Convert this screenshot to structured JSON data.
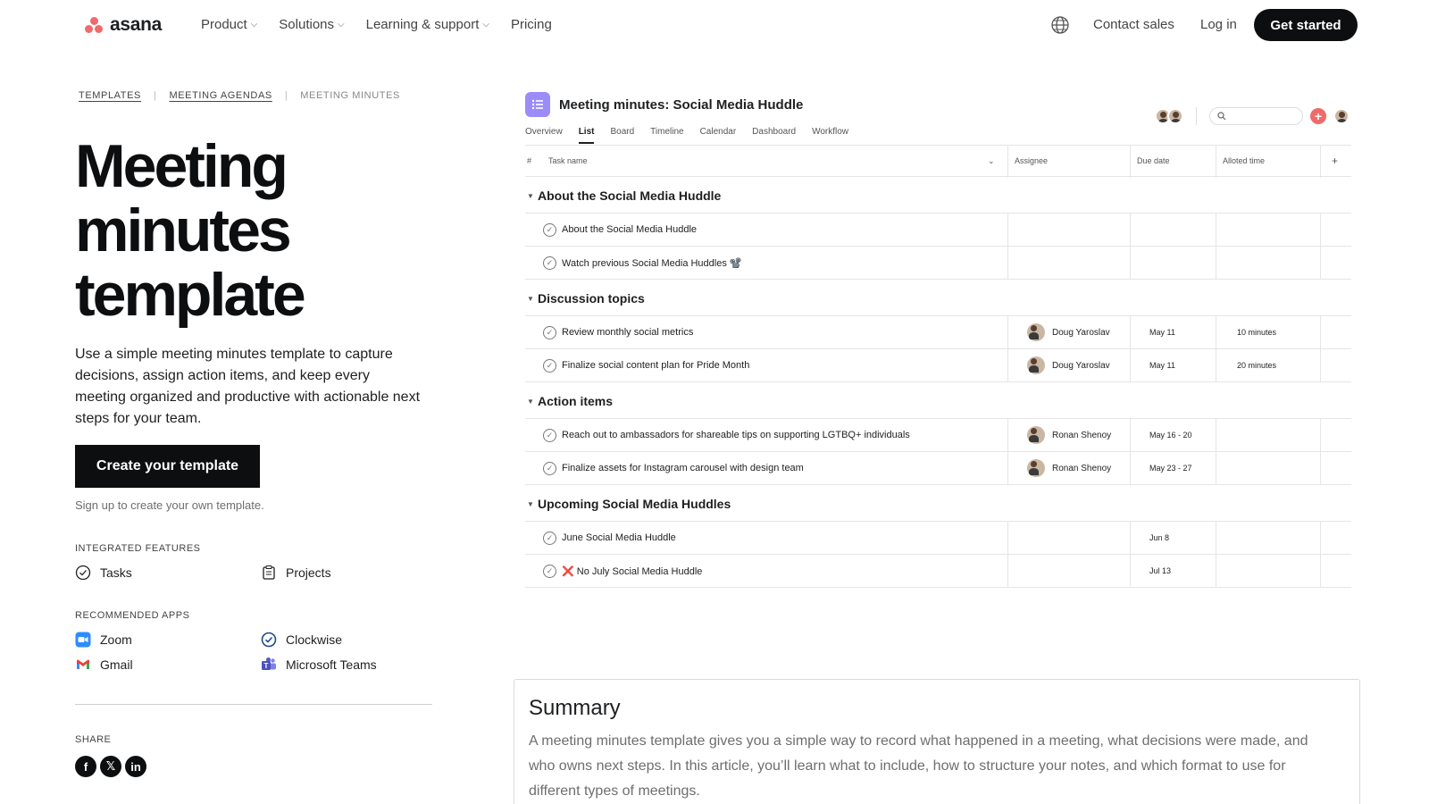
{
  "nav": {
    "brand": "asana",
    "menu": [
      {
        "label": "Product",
        "has_dropdown": true
      },
      {
        "label": "Solutions",
        "has_dropdown": true
      },
      {
        "label": "Learning & support",
        "has_dropdown": true
      },
      {
        "label": "Pricing",
        "has_dropdown": false
      }
    ],
    "language_icon": "globe-icon",
    "contact_sales": "Contact sales",
    "log_in": "Log in",
    "get_started": "Get started"
  },
  "breadcrumbs": [
    "TEMPLATES",
    "MEETING AGENDAS",
    "MEETING MINUTES"
  ],
  "hero": {
    "title_lines": [
      "Meeting",
      "minutes",
      "template"
    ],
    "description": "Use a simple meeting minutes template to capture decisions, assign action items, and keep every meeting organized and productive with actionable next steps for your team.",
    "cta": "Create your template",
    "signup_note": "Sign up to create your own template."
  },
  "integrated_features": {
    "label": "INTEGRATED FEATURES",
    "items": [
      {
        "label": "Tasks",
        "icon": "check-circle-icon"
      },
      {
        "label": "Projects",
        "icon": "clipboard-icon"
      }
    ]
  },
  "recommended_apps": {
    "label": "RECOMMENDED APPS",
    "items": [
      {
        "label": "Zoom",
        "icon": "zoom-icon"
      },
      {
        "label": "Clockwise",
        "icon": "clockwise-icon"
      },
      {
        "label": "Gmail",
        "icon": "gmail-icon"
      },
      {
        "label": "Microsoft Teams",
        "icon": "teams-icon"
      }
    ]
  },
  "share": {
    "label": "SHARE",
    "icons": [
      "facebook-icon",
      "x-icon",
      "linkedin-icon"
    ]
  },
  "project": {
    "title": "Meeting minutes: Social Media Huddle",
    "tabs": [
      "Overview",
      "List",
      "Board",
      "Timeline",
      "Calendar",
      "Dashboard",
      "Workflow"
    ],
    "active_tab": "List",
    "columns": {
      "num": "#",
      "task": "Task name",
      "assignee": "Assignee",
      "due": "Due date",
      "alloted": "Alloted time",
      "add": "+"
    },
    "sections": [
      {
        "name": "About the Social Media Huddle",
        "tasks": [
          {
            "name": "About the Social Media Huddle",
            "assignee": "",
            "due": "",
            "alloted": ""
          },
          {
            "name": "Watch previous Social Media Huddles 📽️",
            "assignee": "",
            "due": "",
            "alloted": ""
          }
        ]
      },
      {
        "name": "Discussion topics",
        "tasks": [
          {
            "name": "Review monthly social metrics",
            "assignee": "Doug Yaroslav",
            "due": "May 11",
            "alloted": "10 minutes"
          },
          {
            "name": "Finalize social content plan for Pride Month",
            "assignee": "Doug Yaroslav",
            "due": "May 11",
            "alloted": "20 minutes"
          }
        ]
      },
      {
        "name": "Action items",
        "tasks": [
          {
            "name": "Reach out to ambassadors for shareable tips on supporting LGTBQ+ individuals",
            "assignee": "Ronan Shenoy",
            "due": "May 16 - 20",
            "alloted": ""
          },
          {
            "name": "Finalize assets for Instagram carousel with design team",
            "assignee": "Ronan Shenoy",
            "due": "May 23 - 27",
            "alloted": ""
          }
        ]
      },
      {
        "name": "Upcoming Social Media Huddles",
        "tasks": [
          {
            "name": "June Social Media Huddle",
            "assignee": "",
            "due": "Jun 8",
            "alloted": ""
          },
          {
            "name": "❌ No July Social Media Huddle",
            "assignee": "",
            "due": "Jul 13",
            "alloted": ""
          }
        ]
      }
    ]
  },
  "summary": {
    "heading": "Summary",
    "text": "A meeting minutes template gives you a simple way to record what happened in a meeting, what decisions were made, and who owns next steps. In this article, you’ll learn what to include, how to structure your notes, and which format to use for different types of meetings."
  },
  "colors": {
    "brand_coral": "#f06a6a",
    "primary_dark": "#0d0e10",
    "project_icon": "#9b8cf8"
  }
}
